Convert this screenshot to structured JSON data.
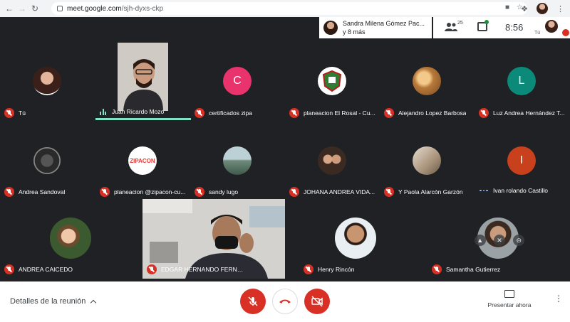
{
  "browser": {
    "url_host": "meet.google.com",
    "url_path": "/sjh-dyxs-ckp",
    "icons": [
      "back-icon",
      "forward-icon",
      "reload-icon",
      "lock-icon",
      "camera-blocked-icon",
      "star-icon",
      "extensions-icon",
      "profile-avatar",
      "kebab-icon"
    ]
  },
  "presenter": {
    "line1": "Sandra Milena Gómez Pac...",
    "line2": "y 8 más"
  },
  "status": {
    "people_count": "25",
    "time": "8:56",
    "self_label": "Tú"
  },
  "participants": [
    {
      "name": "Tú",
      "type": "photo",
      "muted": true
    },
    {
      "name": "Juan Ricardo Mozo",
      "type": "video",
      "speaking": true
    },
    {
      "name": "certificados zipa",
      "type": "initial",
      "initial": "C",
      "color": "#e8336d",
      "muted": true
    },
    {
      "name": "planeacion El Rosal - Cu...",
      "type": "logo",
      "muted": true
    },
    {
      "name": "Alejandro Lopez Barbosa",
      "type": "photo",
      "muted": true
    },
    {
      "name": "Luz Andrea Hernández T...",
      "type": "initial",
      "initial": "L",
      "color": "#0b8a7a",
      "muted": true
    },
    {
      "name": "Andrea Sandoval",
      "type": "photo",
      "muted": true
    },
    {
      "name": "planeacion @zipacon-cu...",
      "type": "logo",
      "logo_text": "ZIPACON",
      "muted": true
    },
    {
      "name": "sandy lugo",
      "type": "photo",
      "muted": true
    },
    {
      "name": "JOHANA ANDREA VIDA...",
      "type": "photo",
      "muted": true
    },
    {
      "name": "Y Paola Alarcón Garzón",
      "type": "photo",
      "muted": true
    },
    {
      "name": "Ivan rolando Castillo",
      "type": "initial",
      "initial": "I",
      "color": "#c8401c",
      "muted": false
    },
    {
      "name": "ANDREA CAICEDO",
      "type": "photo",
      "muted": true
    },
    {
      "name": "EDGAR HERNANDO FERNANDEZ GRILLO",
      "type": "video",
      "muted": true
    },
    {
      "name": "Henry Rincón",
      "type": "photo",
      "muted": true
    },
    {
      "name": "Samantha Gutierrez",
      "type": "photo",
      "muted": true
    }
  ],
  "bottom": {
    "details_label": "Detalles de la reunión",
    "present_label": "Presentar ahora"
  },
  "colors": {
    "danger": "#d93025",
    "speaking": "#7fe3c8",
    "background": "#202124"
  }
}
